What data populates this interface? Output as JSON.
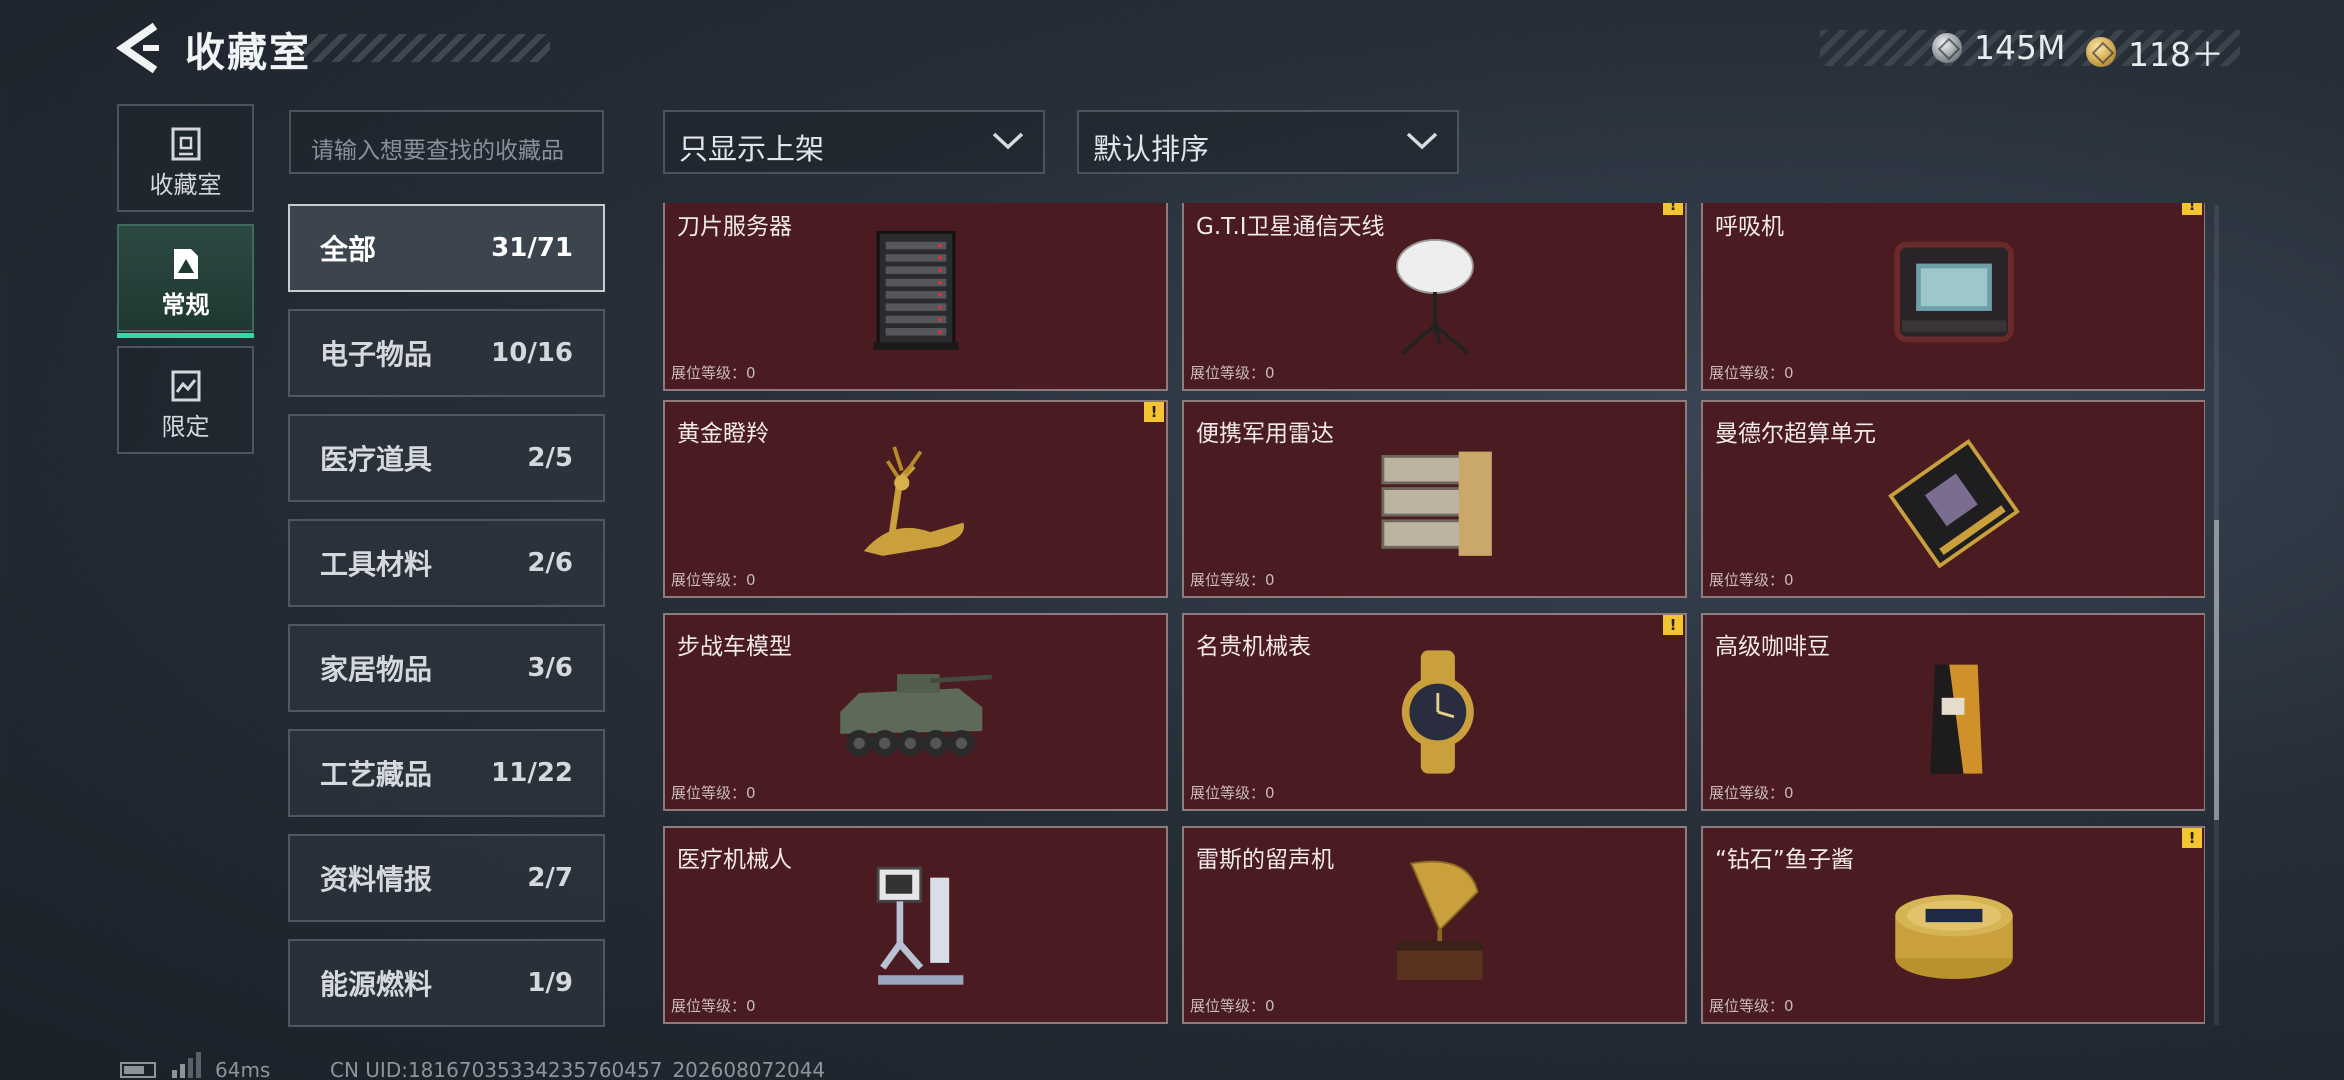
{
  "header": {
    "title": "收藏室",
    "currencies": [
      {
        "icon": "silver-coin-icon",
        "value": "145M"
      },
      {
        "icon": "gold-coin-icon",
        "value": "118＋"
      }
    ]
  },
  "nav": {
    "tabs": [
      {
        "label": "收藏室",
        "icon": "collection-room-icon",
        "active": false
      },
      {
        "label": "常规",
        "icon": "regular-icon",
        "active": true
      },
      {
        "label": "限定",
        "icon": "limited-icon",
        "active": false
      }
    ]
  },
  "search": {
    "placeholder": "请输入想要查找的收藏品"
  },
  "filters": {
    "listed": "只显示上架",
    "sort": "默认排序"
  },
  "categories": [
    {
      "name": "全部",
      "count": "31/71",
      "active": true
    },
    {
      "name": "电子物品",
      "count": "10/16"
    },
    {
      "name": "医疗道具",
      "count": "2/5"
    },
    {
      "name": "工具材料",
      "count": "2/6"
    },
    {
      "name": "家居物品",
      "count": "3/6"
    },
    {
      "name": "工艺藏品",
      "count": "11/22"
    },
    {
      "name": "资料情报",
      "count": "2/7"
    },
    {
      "name": "能源燃料",
      "count": "1/9"
    }
  ],
  "level_label": "展位等级：0",
  "items": [
    {
      "name": "刀片服务器",
      "warn": false,
      "icon": "blade-server-icon"
    },
    {
      "name": "G.T.I卫星通信天线",
      "warn": true,
      "icon": "satellite-antenna-icon"
    },
    {
      "name": "呼吸机",
      "warn": true,
      "icon": "ventilator-icon"
    },
    {
      "name": "黄金瞪羚",
      "warn": true,
      "icon": "golden-gazelle-icon"
    },
    {
      "name": "便携军用雷达",
      "warn": false,
      "icon": "military-radar-icon"
    },
    {
      "name": "曼德尔超算单元",
      "warn": false,
      "icon": "supercomputer-unit-icon"
    },
    {
      "name": "步战车模型",
      "warn": false,
      "icon": "ifv-model-icon"
    },
    {
      "name": "名贵机械表",
      "warn": true,
      "icon": "mechanical-watch-icon"
    },
    {
      "name": "高级咖啡豆",
      "warn": false,
      "icon": "coffee-bean-icon"
    },
    {
      "name": "医疗机械人",
      "warn": false,
      "icon": "medical-robot-icon"
    },
    {
      "name": "雷斯的留声机",
      "warn": false,
      "icon": "gramophone-icon"
    },
    {
      "name": "“钻石”鱼子酱",
      "warn": true,
      "icon": "caviar-icon"
    }
  ],
  "warn_mark": "!",
  "footer": {
    "ping": "64ms",
    "uid": "CN UID:1816703533423576045​7_202608072044"
  }
}
